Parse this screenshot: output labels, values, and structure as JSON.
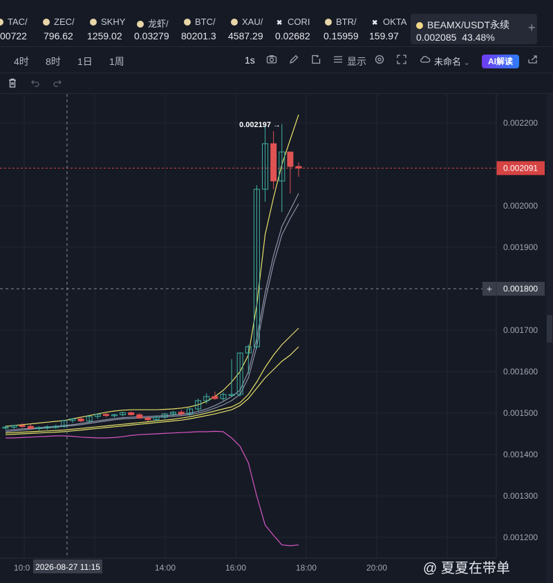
{
  "tickers": [
    {
      "name": "TAC/",
      "price": "00722",
      "icon": "coin-icon"
    },
    {
      "name": "ZEC/",
      "price": "796.62",
      "icon": "coin-icon"
    },
    {
      "name": "SKHY",
      "price": "1259.02",
      "icon": "coin-icon"
    },
    {
      "name": "龙虾/",
      "price": "0.03279",
      "icon": "coin-icon"
    },
    {
      "name": "BTC/",
      "price": "80201.3",
      "icon": "coin-icon"
    },
    {
      "name": "XAU/",
      "price": "4587.29",
      "icon": "coin-icon"
    },
    {
      "name": "CORI",
      "price": "0.02682",
      "icon": "cross-icon"
    },
    {
      "name": "BTR/",
      "price": "0.15959",
      "icon": "coin-icon"
    },
    {
      "name": "OKTA",
      "price": "159.97",
      "icon": "cross-icon"
    }
  ],
  "active_ticker": {
    "name": "BEAMX/USDT永续",
    "price": "0.002085",
    "change": "43.48%"
  },
  "add_ticker_label": "+",
  "timeframes": [
    "4时",
    "8时",
    "1日",
    "1周"
  ],
  "toolbar": {
    "interval": "1s",
    "display_label": "显示",
    "layout_label": "未命名",
    "ai_label": "AI解读"
  },
  "colors": {
    "up": "#3fb3a3",
    "down": "#e05353",
    "ma_yellow": "#e8e36a",
    "ma_gray": "#8d93a8",
    "ma_pink": "#d857c4",
    "price_tag": "#d64343"
  },
  "chart_data": {
    "type": "candlestick",
    "y_ticks": [
      "0.002200",
      "0.002000",
      "0.001900",
      "0.001700",
      "0.001600",
      "0.001500",
      "0.001400",
      "0.001300",
      "0.001200"
    ],
    "x_ticks": [
      "14:00",
      "16:00",
      "18:00",
      "20:00"
    ],
    "crosshair_x_label": "2026-08-27 11:15",
    "x_tick_partial": "10:0",
    "crosshair_y_label": "0.001800",
    "last_price_label": "0.002091",
    "high_annotation": "0.002197",
    "last_price": 0.002091,
    "crosshair_price": 0.0018,
    "high_price": 0.002197,
    "ylim": [
      0.00115,
      0.00227
    ],
    "candles": [
      {
        "o": 0.001465,
        "h": 0.00147,
        "l": 0.00146,
        "c": 0.001466
      },
      {
        "o": 0.001466,
        "h": 0.001472,
        "l": 0.001462,
        "c": 0.00147
      },
      {
        "o": 0.00147,
        "h": 0.001476,
        "l": 0.001464,
        "c": 0.001468
      },
      {
        "o": 0.001468,
        "h": 0.001474,
        "l": 0.001462,
        "c": 0.001463
      },
      {
        "o": 0.001463,
        "h": 0.001468,
        "l": 0.001458,
        "c": 0.001465
      },
      {
        "o": 0.001465,
        "h": 0.00147,
        "l": 0.00146,
        "c": 0.001467
      },
      {
        "o": 0.001467,
        "h": 0.001472,
        "l": 0.001462,
        "c": 0.001468
      },
      {
        "o": 0.001468,
        "h": 0.001484,
        "l": 0.001464,
        "c": 0.001482
      },
      {
        "o": 0.001482,
        "h": 0.001488,
        "l": 0.001476,
        "c": 0.001486
      },
      {
        "o": 0.001486,
        "h": 0.00149,
        "l": 0.001478,
        "c": 0.001481
      },
      {
        "o": 0.001481,
        "h": 0.001494,
        "l": 0.001476,
        "c": 0.001492
      },
      {
        "o": 0.001492,
        "h": 0.001498,
        "l": 0.001486,
        "c": 0.001497
      },
      {
        "o": 0.001497,
        "h": 0.0015,
        "l": 0.00149,
        "c": 0.001494
      },
      {
        "o": 0.001494,
        "h": 0.001498,
        "l": 0.00149,
        "c": 0.001496
      },
      {
        "o": 0.001496,
        "h": 0.001503,
        "l": 0.001492,
        "c": 0.001501
      },
      {
        "o": 0.001501,
        "h": 0.001504,
        "l": 0.001494,
        "c": 0.001496
      },
      {
        "o": 0.001496,
        "h": 0.0015,
        "l": 0.001486,
        "c": 0.001488
      },
      {
        "o": 0.001488,
        "h": 0.001492,
        "l": 0.00148,
        "c": 0.001484
      },
      {
        "o": 0.001484,
        "h": 0.001494,
        "l": 0.00148,
        "c": 0.00149
      },
      {
        "o": 0.00149,
        "h": 0.0015,
        "l": 0.001486,
        "c": 0.001498
      },
      {
        "o": 0.001498,
        "h": 0.001505,
        "l": 0.001492,
        "c": 0.001502
      },
      {
        "o": 0.001502,
        "h": 0.001508,
        "l": 0.001494,
        "c": 0.001498
      },
      {
        "o": 0.001498,
        "h": 0.001512,
        "l": 0.001494,
        "c": 0.00151
      },
      {
        "o": 0.00151,
        "h": 0.001535,
        "l": 0.001505,
        "c": 0.00153
      },
      {
        "o": 0.00153,
        "h": 0.001548,
        "l": 0.001522,
        "c": 0.00154
      },
      {
        "o": 0.00154,
        "h": 0.001552,
        "l": 0.001532,
        "c": 0.001535
      },
      {
        "o": 0.001535,
        "h": 0.00155,
        "l": 0.00153,
        "c": 0.001545
      },
      {
        "o": 0.001545,
        "h": 0.00163,
        "l": 0.00154,
        "c": 0.001545
      },
      {
        "o": 0.001545,
        "h": 0.001645,
        "l": 0.00154,
        "c": 0.001645
      },
      {
        "o": 0.001645,
        "h": 0.001665,
        "l": 0.001595,
        "c": 0.00166
      },
      {
        "o": 0.00166,
        "h": 0.00205,
        "l": 0.001655,
        "c": 0.00204
      },
      {
        "o": 0.00204,
        "h": 0.002195,
        "l": 0.00201,
        "c": 0.00215
      },
      {
        "o": 0.00215,
        "h": 0.00218,
        "l": 0.00204,
        "c": 0.00206
      },
      {
        "o": 0.00206,
        "h": 0.002197,
        "l": 0.001985,
        "c": 0.00213
      },
      {
        "o": 0.00213,
        "h": 0.002125,
        "l": 0.00203,
        "c": 0.002095
      },
      {
        "o": 0.002095,
        "h": 0.002105,
        "l": 0.00207,
        "c": 0.002091
      }
    ],
    "series": [
      {
        "color_key": "ma_yellow",
        "values": [
          0.001468,
          0.00147,
          0.001472,
          0.001474,
          0.001476,
          0.001478,
          0.00148,
          0.001482,
          0.001486,
          0.00149,
          0.001494,
          0.001498,
          0.001502,
          0.001505,
          0.001507,
          0.001508,
          0.001508,
          0.001508,
          0.001508,
          0.001509,
          0.00151,
          0.001512,
          0.001515,
          0.00152,
          0.001528,
          0.00154,
          0.001555,
          0.001575,
          0.0016,
          0.00164,
          0.00176,
          0.00193,
          0.00202,
          0.0021,
          0.00216,
          0.00222
        ]
      },
      {
        "color_key": "ma_gray",
        "values": [
          0.001458,
          0.00146,
          0.001462,
          0.001463,
          0.001465,
          0.001466,
          0.001468,
          0.00147,
          0.001472,
          0.001475,
          0.001478,
          0.001481,
          0.001484,
          0.001487,
          0.001489,
          0.00149,
          0.001491,
          0.001492,
          0.001493,
          0.001494,
          0.001495,
          0.001497,
          0.0015,
          0.001504,
          0.00151,
          0.001518,
          0.001528,
          0.00154,
          0.001555,
          0.0016,
          0.00168,
          0.00179,
          0.00188,
          0.00195,
          0.00199,
          0.00203
        ]
      },
      {
        "color_key": "ma_gray",
        "values": [
          0.001455,
          0.001457,
          0.001459,
          0.001461,
          0.001463,
          0.001464,
          0.001466,
          0.001468,
          0.00147,
          0.001472,
          0.001475,
          0.001478,
          0.001481,
          0.001484,
          0.001486,
          0.001487,
          0.001488,
          0.001489,
          0.00149,
          0.001491,
          0.001492,
          0.001494,
          0.001496,
          0.0015,
          0.001505,
          0.001512,
          0.00152,
          0.00153,
          0.001545,
          0.001585,
          0.00166,
          0.00177,
          0.00186,
          0.00193,
          0.00197,
          0.002005
        ]
      },
      {
        "color_key": "ma_yellow",
        "values": [
          0.001452,
          0.001453,
          0.001454,
          0.001455,
          0.001456,
          0.001457,
          0.001458,
          0.001459,
          0.001461,
          0.001463,
          0.001465,
          0.001467,
          0.001469,
          0.001471,
          0.001473,
          0.001475,
          0.001477,
          0.001479,
          0.001481,
          0.001483,
          0.001485,
          0.001488,
          0.001491,
          0.001495,
          0.0015,
          0.001505,
          0.00151,
          0.001515,
          0.001525,
          0.001545,
          0.001575,
          0.00161,
          0.00164,
          0.001665,
          0.001685,
          0.001705
        ]
      },
      {
        "color_key": "ma_yellow",
        "values": [
          0.001448,
          0.001449,
          0.00145,
          0.001451,
          0.001452,
          0.001453,
          0.001454,
          0.001455,
          0.001457,
          0.001459,
          0.001461,
          0.001463,
          0.001465,
          0.001467,
          0.001469,
          0.001471,
          0.001473,
          0.001475,
          0.001477,
          0.001479,
          0.001481,
          0.001483,
          0.001486,
          0.00149,
          0.001494,
          0.001498,
          0.001503,
          0.001508,
          0.001518,
          0.001535,
          0.00156,
          0.001585,
          0.001605,
          0.001625,
          0.00164,
          0.00166
        ]
      },
      {
        "color_key": "ma_pink",
        "values": [
          0.00144,
          0.00144,
          0.001441,
          0.001442,
          0.001443,
          0.001444,
          0.001445,
          0.001445,
          0.001444,
          0.001442,
          0.001441,
          0.00144,
          0.00144,
          0.001441,
          0.001443,
          0.001446,
          0.001448,
          0.001449,
          0.00145,
          0.001451,
          0.001452,
          0.001453,
          0.001454,
          0.001455,
          0.001455,
          0.001456,
          0.001455,
          0.00144,
          0.00142,
          0.00138,
          0.0013,
          0.00123,
          0.001205,
          0.001182,
          0.00118,
          0.001182
        ]
      }
    ]
  },
  "watermark": "@ 夏夏在带单"
}
